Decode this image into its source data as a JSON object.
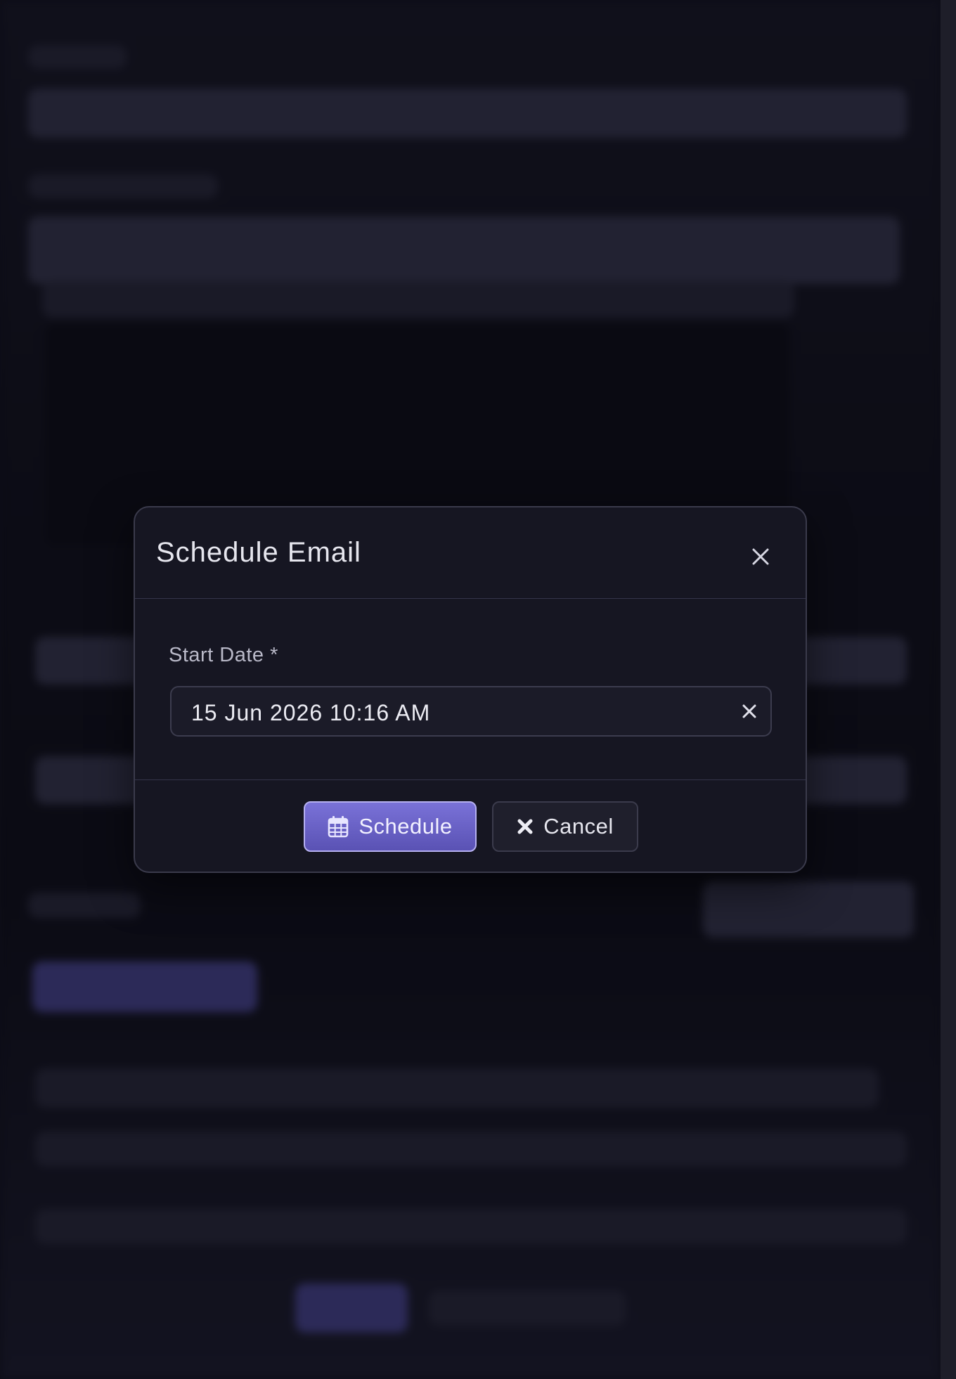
{
  "modal": {
    "title": "Schedule Email",
    "close_icon": "close-icon"
  },
  "form": {
    "start_date": {
      "label": "Start Date *",
      "value": "15 Jun 2026 10:16 AM",
      "clear_icon": "clear-icon"
    }
  },
  "actions": {
    "schedule": {
      "label": "Schedule",
      "icon": "calendar-icon"
    },
    "cancel": {
      "label": "Cancel",
      "icon": "x-mark-icon"
    }
  },
  "colors": {
    "accent": "#6b63c9",
    "accent_border": "#b5b0f0",
    "modal_background": "#161622",
    "page_background": "#0d0d17"
  }
}
